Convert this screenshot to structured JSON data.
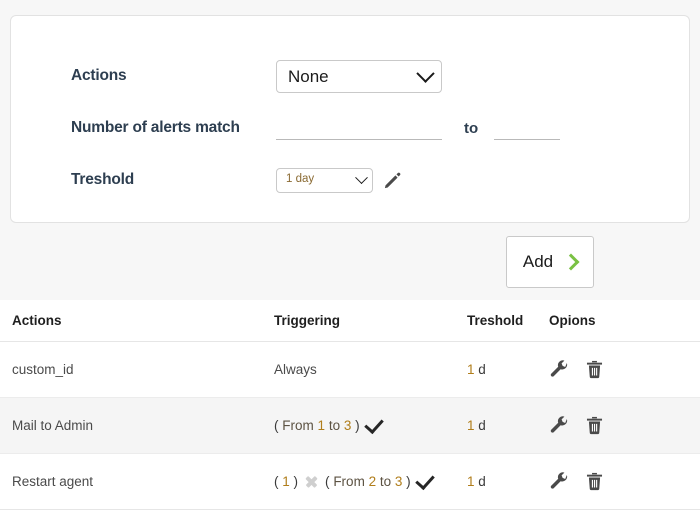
{
  "form": {
    "rows": [
      {
        "label": "Actions"
      },
      {
        "label": "Number of alerts match"
      },
      {
        "label": "Treshold"
      }
    ],
    "actions_select": {
      "value": "None",
      "icon": "chevron-down-icon"
    },
    "alerts_match": {
      "from_value": "",
      "from_placeholder": "",
      "separator": "to",
      "to_value": "",
      "to_placeholder": ""
    },
    "threshold_select": {
      "value": "1 day",
      "icon": "chevron-down-icon"
    },
    "edit_icon": "pencil-icon"
  },
  "add_button": {
    "label": "Add",
    "icon": "chevron-right-icon",
    "accent_color": "#7ac143"
  },
  "table": {
    "headers": [
      "Actions",
      "Triggering",
      "Treshold",
      "Opions"
    ],
    "rows": [
      {
        "action": "custom_id",
        "triggering": {
          "text": "Always",
          "parts": [],
          "status_icon": ""
        },
        "threshold_num": "1",
        "threshold_unit": "d",
        "options": [
          "wrench-icon",
          "trash-icon"
        ]
      },
      {
        "action": "Mail to Admin",
        "triggering": {
          "text": "( From 1 to 3 )",
          "parts": [
            {
              "paren_open": "(",
              "kw_from": "From",
              "num_a": "1",
              "kw_to": "to",
              "num_b": "3",
              "paren_close": ")"
            }
          ],
          "status_icon": "check-icon"
        },
        "threshold_num": "1",
        "threshold_unit": "d",
        "options": [
          "wrench-icon",
          "trash-icon"
        ]
      },
      {
        "action": "Restart agent",
        "triggering": {
          "text": "( 1 ) ✕ ( From 2 to 3 )",
          "group_a": {
            "paren_open": "(",
            "num": "1",
            "paren_close": ")"
          },
          "separator_icon": "x-icon",
          "group_b": {
            "paren_open": "(",
            "kw_from": "From",
            "num_a": "2",
            "kw_to": "to",
            "num_b": "3",
            "paren_close": ")"
          },
          "status_icon": "check-icon"
        },
        "threshold_num": "1",
        "threshold_unit": "d",
        "options": [
          "wrench-icon",
          "trash-icon"
        ]
      }
    ]
  },
  "colors": {
    "page_bg": "#f7f7f7",
    "card_bg": "#ffffff",
    "label": "#2d3e50",
    "number_accent": "#b07d1a",
    "add_accent": "#7ac143",
    "alt_row": "#f5f5f5"
  }
}
